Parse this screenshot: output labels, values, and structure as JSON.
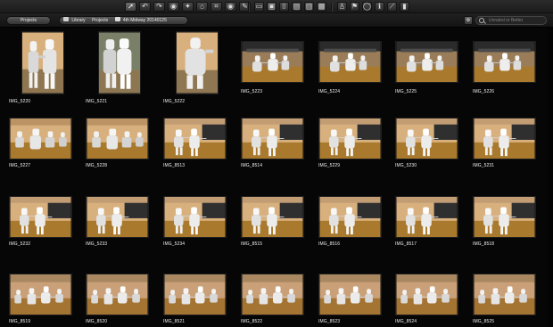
{
  "toolbar": {
    "icons": [
      {
        "name": "cursor-icon",
        "glyph": "➚",
        "active": true
      },
      {
        "name": "rotate-left-icon",
        "glyph": "↶"
      },
      {
        "name": "rotate-right-icon",
        "glyph": "↷"
      },
      {
        "name": "camera-icon",
        "glyph": "◉"
      },
      {
        "name": "enhance-icon",
        "glyph": "✦"
      },
      {
        "name": "straighten-icon",
        "glyph": "⌂"
      },
      {
        "name": "crop-icon",
        "glyph": "⌗"
      },
      {
        "name": "eye-icon",
        "glyph": "◉"
      },
      {
        "name": "brush-icon",
        "glyph": "✎"
      },
      {
        "name": "card-icon",
        "glyph": "▭"
      },
      {
        "name": "picture-icon",
        "glyph": "▣"
      },
      {
        "name": "crop-tool-icon",
        "glyph": "⌷"
      },
      {
        "name": "adjust-icon",
        "glyph": "▤"
      },
      {
        "name": "compare-icon",
        "glyph": "▥"
      },
      {
        "name": "export-icon",
        "glyph": "▦"
      },
      {
        "name": "person-icon",
        "glyph": "♙"
      },
      {
        "name": "flag-icon",
        "glyph": "⚑"
      },
      {
        "name": "circle-icon",
        "glyph": "◯"
      },
      {
        "name": "info-icon",
        "glyph": "ℹ"
      },
      {
        "name": "eyedropper-icon",
        "glyph": "⟋"
      },
      {
        "name": "bottle-icon",
        "glyph": "▮"
      }
    ]
  },
  "navbar": {
    "projects_label": "Projects",
    "library_label": "Library",
    "projects_crumb_label": "Projects",
    "album_label": "4th Midway 20140125",
    "search_menu_icon": "gear-icon",
    "search_placeholder": "Unrated or Better"
  },
  "photos": [
    {
      "label": "IMG_5220",
      "orientation": "portrait",
      "scene": "two-fencers-standing"
    },
    {
      "label": "IMG_5221",
      "orientation": "portrait",
      "scene": "two-fencers-close"
    },
    {
      "label": "IMG_5222",
      "orientation": "portrait",
      "scene": "fencer-portrait"
    },
    {
      "label": "IMG_5223",
      "orientation": "landscape",
      "scene": "bout-wide"
    },
    {
      "label": "IMG_5224",
      "orientation": "landscape",
      "scene": "bout-wide"
    },
    {
      "label": "IMG_5225",
      "orientation": "landscape",
      "scene": "bout-wide"
    },
    {
      "label": "IMG_5226",
      "orientation": "landscape",
      "scene": "bout-wide"
    },
    {
      "label": "IMG_5227",
      "orientation": "landscape",
      "scene": "group-standing"
    },
    {
      "label": "IMG_5228",
      "orientation": "landscape",
      "scene": "group-standing"
    },
    {
      "label": "IMG_8513",
      "orientation": "landscape",
      "scene": "bout-action"
    },
    {
      "label": "IMG_8514",
      "orientation": "landscape",
      "scene": "bout-action"
    },
    {
      "label": "IMG_5229",
      "orientation": "landscape",
      "scene": "bout-action"
    },
    {
      "label": "IMG_5230",
      "orientation": "landscape",
      "scene": "bout-action"
    },
    {
      "label": "IMG_5231",
      "orientation": "landscape",
      "scene": "bout-action"
    },
    {
      "label": "IMG_5232",
      "orientation": "landscape",
      "scene": "bout-action"
    },
    {
      "label": "IMG_5233",
      "orientation": "landscape",
      "scene": "bout-action"
    },
    {
      "label": "IMG_5234",
      "orientation": "landscape",
      "scene": "bout-action"
    },
    {
      "label": "IMG_8515",
      "orientation": "landscape",
      "scene": "bout-action"
    },
    {
      "label": "IMG_8516",
      "orientation": "landscape",
      "scene": "bout-action"
    },
    {
      "label": "IMG_8517",
      "orientation": "landscape",
      "scene": "bout-action"
    },
    {
      "label": "IMG_8518",
      "orientation": "landscape",
      "scene": "bout-action"
    },
    {
      "label": "IMG_8519",
      "orientation": "landscape",
      "scene": "line-up"
    },
    {
      "label": "IMG_8520",
      "orientation": "landscape",
      "scene": "line-up"
    },
    {
      "label": "IMG_8521",
      "orientation": "landscape",
      "scene": "line-up"
    },
    {
      "label": "IMG_8522",
      "orientation": "landscape",
      "scene": "line-up"
    },
    {
      "label": "IMG_8523",
      "orientation": "landscape",
      "scene": "line-up"
    },
    {
      "label": "IMG_8524",
      "orientation": "landscape",
      "scene": "line-up"
    },
    {
      "label": "IMG_8525",
      "orientation": "landscape",
      "scene": "line-up"
    }
  ],
  "colors": {
    "background": "#060606",
    "caption": "#f0f0f0",
    "thumb_floor": "#a97a2e",
    "thumb_wall": "#d8b07d"
  }
}
